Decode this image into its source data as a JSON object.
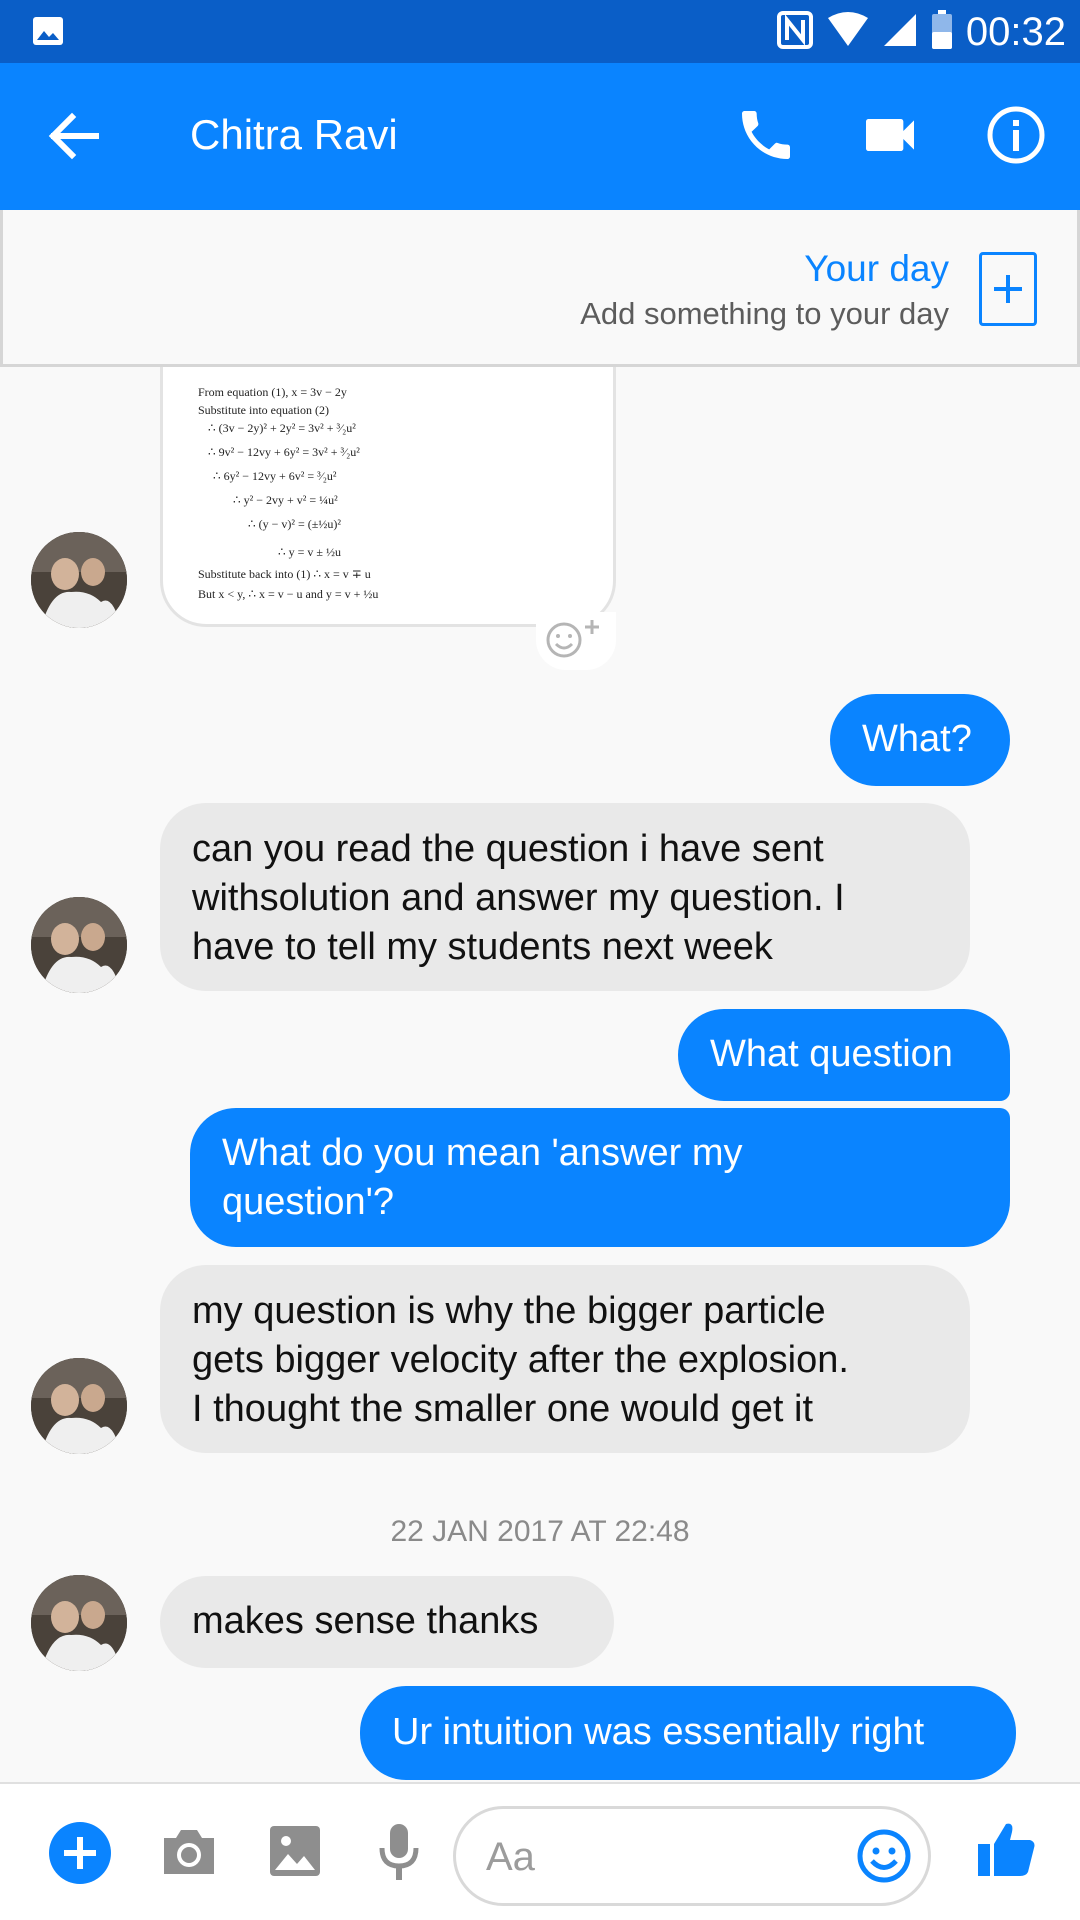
{
  "status_bar": {
    "time": "00:32"
  },
  "header": {
    "contact_name": "Chitra Ravi"
  },
  "your_day": {
    "title": "Your day",
    "subtitle": "Add something to your day"
  },
  "image_message": {
    "lines": [
      "From equation (1),  x = 3v − 2y",
      "Substitute into equation (2)",
      "∴ (3v − 2y)² + 2y² = 3v² + ³⁄₂u²",
      "∴ 9v² − 12vy + 6y² = 3v² + ³⁄₂u²",
      "∴ 6y² − 12vy + 6v² = ³⁄₂u²",
      "∴ y² − 2vy + v² = ¼u²",
      "∴ (y − v)² = (±½u)²",
      "∴ y = v ± ½u",
      "Substitute back into (1)  ∴ x = v ∓ u",
      "But  x < y, ∴ x = v − u  and  y = v + ½u"
    ]
  },
  "messages": [
    {
      "dir": "out",
      "text": "What?"
    },
    {
      "dir": "in",
      "lines": [
        "can you read the question i have sent",
        "withsolution and answer my question.  I",
        "have to tell my students next week"
      ]
    },
    {
      "dir": "out",
      "text": "What question"
    },
    {
      "dir": "out",
      "lines": [
        "What do you mean 'answer my",
        "question'?"
      ]
    },
    {
      "dir": "in",
      "lines": [
        "my question is why the bigger particle",
        "gets bigger velocity after the explosion.",
        "I thought the smaller one would get it"
      ]
    },
    {
      "dir": "in",
      "text": "makes sense  thanks"
    },
    {
      "dir": "out",
      "text": "Ur intuition was essentially right"
    }
  ],
  "timestamp": "22 JAN 2017 AT 22:48",
  "composer": {
    "placeholder": "Aa"
  },
  "colors": {
    "accent": "#0a84ff",
    "status_bar": "#0a5ec7",
    "incoming_bubble": "#e9e9e9"
  },
  "icons": [
    "gallery-icon",
    "nfc-icon",
    "wifi-icon",
    "signal-icon",
    "battery-icon",
    "back-arrow-icon",
    "phone-icon",
    "video-icon",
    "info-icon",
    "plus-icon",
    "add-reaction-icon",
    "camera-icon",
    "image-icon",
    "mic-icon",
    "emoji-icon",
    "thumbs-up-icon"
  ]
}
